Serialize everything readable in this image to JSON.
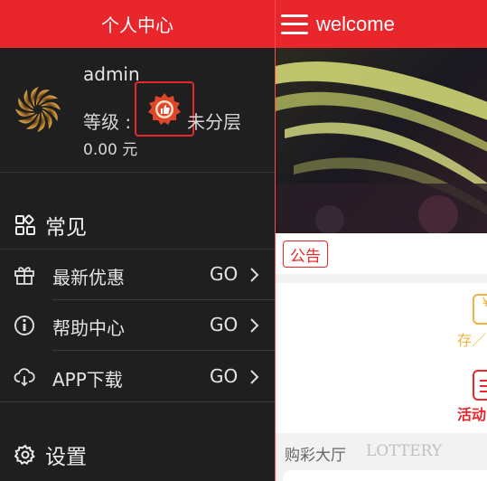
{
  "drawer": {
    "title": "个人中心",
    "profile": {
      "username": "admin",
      "level_label": "等级 :",
      "level_value": "未分层",
      "balance": "0.00 元"
    },
    "common_section": "常见",
    "items": [
      {
        "label": "最新优惠",
        "action": "GO",
        "icon": "gift-icon"
      },
      {
        "label": "帮助中心",
        "action": "GO",
        "icon": "info-icon"
      },
      {
        "label": "APP下载",
        "action": "GO",
        "icon": "cloud-download-icon"
      }
    ],
    "settings_section": "设置"
  },
  "main": {
    "title": "welcome",
    "notice_tag": "公告",
    "quick": [
      {
        "label": "存／",
        "color": "#f0b340",
        "icon": "yen-wallet-icon"
      },
      {
        "label": "活动",
        "color": "#e8262b",
        "icon": "activity-icon"
      }
    ],
    "lottery_title": "购彩大厅",
    "lottery_en": "LOTTERY"
  },
  "colors": {
    "brand_red": "#e8262b",
    "drawer_bg": "#1f1f1f",
    "accent_gold": "#f0b340"
  }
}
